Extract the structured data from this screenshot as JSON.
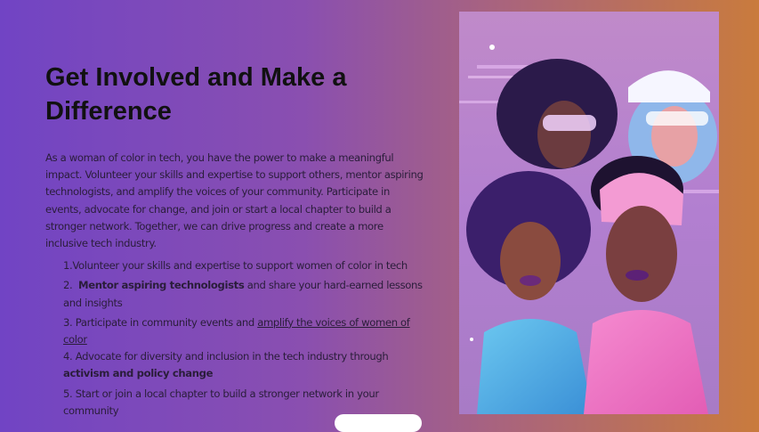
{
  "section": {
    "title": "Get Involved and Make a Difference",
    "intro": "As a woman of color in tech, you have the power to make a meaningful impact. Volunteer your skills and expertise to support others, mentor aspiring technologists, and amplify the voices of your community. Participate in events, advocate for change, and join or start a local chapter to build a stronger network. Together, we can drive progress and create a more inclusive tech industry.",
    "steps": {
      "s1": {
        "num": "1.",
        "text": "Volunteer your skills and expertise to support women of color in tech"
      },
      "s2": {
        "num": "2.",
        "bold": "Mentor aspiring technologists",
        "text": " and share your hard-earned lessons and insights"
      },
      "s3": {
        "num": "3.",
        "text": "Participate in community events and ",
        "link": "amplify the voices of women of color"
      },
      "s4": {
        "num": "4.",
        "text": "Advocate for diversity and inclusion in the tech industry through ",
        "bold": "activism and policy change"
      },
      "s5": {
        "num": "5.",
        "text": "Start or join a local chapter to build a stronger network in your community"
      }
    }
  },
  "colors": {
    "bg_left": "#7144c4",
    "bg_right": "#c97b3d",
    "illustration_bg": "#b77fc6"
  }
}
